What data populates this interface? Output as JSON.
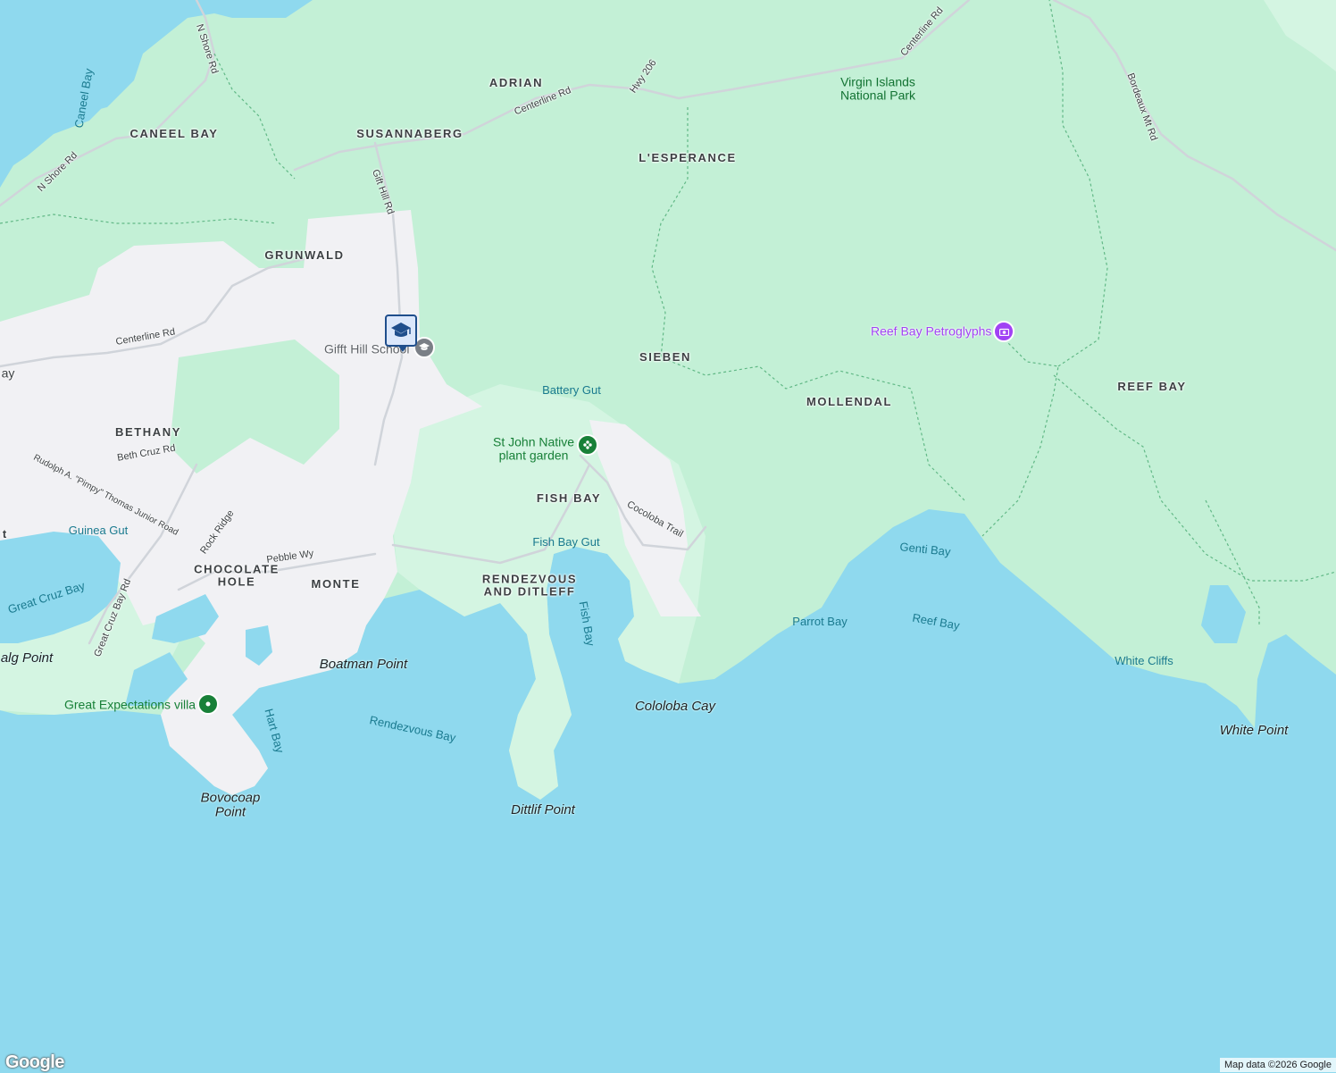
{
  "map": {
    "places": [
      {
        "id": "adrian",
        "text": "ADRIAN"
      },
      {
        "id": "caneel-bay",
        "text": "CANEEL BAY"
      },
      {
        "id": "susannaberg",
        "text": "SUSANNABERG"
      },
      {
        "id": "lesperance",
        "text": "L'ESPERANCE"
      },
      {
        "id": "grunwald",
        "text": "GRUNWALD"
      },
      {
        "id": "sieben",
        "text": "SIEBEN"
      },
      {
        "id": "mollendal",
        "text": "MOLLENDAL"
      },
      {
        "id": "reef-bay-area",
        "text": "REEF BAY"
      },
      {
        "id": "bethany",
        "text": "BETHANY"
      },
      {
        "id": "fish-bay-area",
        "text": "FISH BAY"
      },
      {
        "id": "chocolate-hole",
        "text": "CHOCOLATE\nHOLE"
      },
      {
        "id": "monte",
        "text": "MONTE"
      },
      {
        "id": "rendezvous",
        "text": "RENDEZVOUS\nAND DITLEFF"
      }
    ],
    "roads": [
      {
        "id": "n-shore-rd-top",
        "text": "N Shore Rd"
      },
      {
        "id": "n-shore-rd-left",
        "text": "N Shore Rd"
      },
      {
        "id": "centerline-rd-1",
        "text": "Centerline Rd"
      },
      {
        "id": "hwy-206",
        "text": "Hwy 206"
      },
      {
        "id": "centerline-rd-2",
        "text": "Centerline Rd"
      },
      {
        "id": "bordeaux-mt-rd",
        "text": "Bordeaux Mt Rd"
      },
      {
        "id": "gift-hill-rd",
        "text": "Gift Hill Rd"
      },
      {
        "id": "centerline-rd-3",
        "text": "Centerline Rd"
      },
      {
        "id": "beth-cruz-rd",
        "text": "Beth Cruz Rd"
      },
      {
        "id": "pimpy-rd",
        "text": "Rudolph A. \"Pimpy\" Thomas Junior Road"
      },
      {
        "id": "rock-ridge",
        "text": "Rock Ridge"
      },
      {
        "id": "pebble-wy",
        "text": "Pebble Wy"
      },
      {
        "id": "great-cruz-bay-rd",
        "text": "Great Cruz Bay Rd"
      },
      {
        "id": "cocoloba-trail",
        "text": "Cocoloba Trail"
      }
    ],
    "water": [
      {
        "id": "caneel-bay-water",
        "text": "Caneel Bay"
      },
      {
        "id": "battery-gut",
        "text": "Battery Gut"
      },
      {
        "id": "fish-bay-gut",
        "text": "Fish Bay Gut"
      },
      {
        "id": "guinea-gut",
        "text": "Guinea Gut"
      },
      {
        "id": "great-cruz-bay",
        "text": "Great Cruz Bay"
      },
      {
        "id": "fish-bay-water",
        "text": "Fish Bay"
      },
      {
        "id": "genti-bay",
        "text": "Genti Bay"
      },
      {
        "id": "parrot-bay",
        "text": "Parrot Bay"
      },
      {
        "id": "reef-bay-water",
        "text": "Reef Bay"
      },
      {
        "id": "white-cliffs",
        "text": "White Cliffs"
      },
      {
        "id": "hart-bay",
        "text": "Hart Bay"
      },
      {
        "id": "rendezvous-bay",
        "text": "Rendezvous Bay"
      }
    ],
    "points": [
      {
        "id": "boatman-point",
        "text": "Boatman Point"
      },
      {
        "id": "cololoba-cay",
        "text": "Cololoba Cay"
      },
      {
        "id": "white-point",
        "text": "White Point"
      },
      {
        "id": "dittlif-point",
        "text": "Dittlif Point"
      },
      {
        "id": "bovocoap-point",
        "text": "Bovocoap\nPoint"
      },
      {
        "id": "algs-point",
        "text": "alg Point"
      }
    ],
    "pois": {
      "park": "Virgin Islands\nNational Park",
      "petroglyphs": "Reef Bay Petroglyphs",
      "native_garden": "St John Native\nplant garden",
      "school": "Gifft Hill School",
      "villa": "Great Expectations villa"
    },
    "edge_text": {
      "bay_left": "ay",
      "t_left": "t"
    },
    "attribution": "Map data ©2026 Google",
    "logo": "Google"
  },
  "colors": {
    "water": "#8fd9ee",
    "park": "#c3f0d6",
    "lowland": "#d4f5e2",
    "urban": "#f1f1f4",
    "marker": "#1f4e8c"
  }
}
